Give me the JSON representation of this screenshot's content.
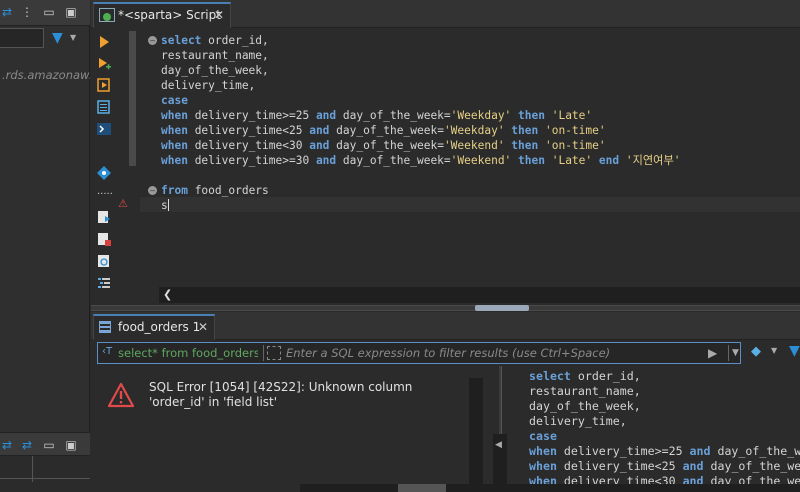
{
  "left_panel": {
    "host_text": ".rds.amazonaw...",
    "icons": [
      "sync-icon",
      "menu-icon",
      "minimize-icon",
      "maximize-icon",
      "filter-icon"
    ]
  },
  "editor": {
    "tab_label": "*<sparta> Script",
    "tab_close": "✕",
    "code_lines": [
      {
        "fold": true,
        "tokens": [
          {
            "t": "select ",
            "c": "kw"
          },
          {
            "t": "order_id,",
            "c": "tx"
          }
        ]
      },
      {
        "tokens": [
          {
            "t": "restaurant_name,",
            "c": "tx"
          }
        ]
      },
      {
        "tokens": [
          {
            "t": "day_of_the_week,",
            "c": "tx"
          }
        ]
      },
      {
        "tokens": [
          {
            "t": "delivery_time,",
            "c": "tx"
          }
        ]
      },
      {
        "tokens": [
          {
            "t": "case",
            "c": "kw"
          }
        ]
      },
      {
        "tokens": [
          {
            "t": "when ",
            "c": "kw"
          },
          {
            "t": "delivery_time>=25 ",
            "c": "tx"
          },
          {
            "t": "and ",
            "c": "kw"
          },
          {
            "t": "day_of_the_week=",
            "c": "tx"
          },
          {
            "t": "'Weekday'",
            "c": "str"
          },
          {
            "t": " then ",
            "c": "kw"
          },
          {
            "t": "'Late'",
            "c": "str"
          }
        ]
      },
      {
        "tokens": [
          {
            "t": "when ",
            "c": "kw"
          },
          {
            "t": "delivery_time<25 ",
            "c": "tx"
          },
          {
            "t": "and ",
            "c": "kw"
          },
          {
            "t": "day_of_the_week=",
            "c": "tx"
          },
          {
            "t": "'Weekday'",
            "c": "str"
          },
          {
            "t": " then ",
            "c": "kw"
          },
          {
            "t": "'on-time'",
            "c": "str"
          }
        ]
      },
      {
        "tokens": [
          {
            "t": "when ",
            "c": "kw"
          },
          {
            "t": "delivery_time<30 ",
            "c": "tx"
          },
          {
            "t": "and ",
            "c": "kw"
          },
          {
            "t": "day_of_the_week=",
            "c": "tx"
          },
          {
            "t": "'Weekend'",
            "c": "str"
          },
          {
            "t": " then ",
            "c": "kw"
          },
          {
            "t": "'on-time'",
            "c": "str"
          }
        ]
      },
      {
        "tokens": [
          {
            "t": "when ",
            "c": "kw"
          },
          {
            "t": "delivery_time>=30 ",
            "c": "tx"
          },
          {
            "t": "and ",
            "c": "kw"
          },
          {
            "t": "day_of_the_week=",
            "c": "tx"
          },
          {
            "t": "'Weekend'",
            "c": "str"
          },
          {
            "t": " then ",
            "c": "kw"
          },
          {
            "t": "'Late'",
            "c": "str"
          },
          {
            "t": " end ",
            "c": "kw"
          },
          {
            "t": "'지연여부'",
            "c": "str"
          }
        ]
      },
      {
        "tokens": []
      },
      {
        "fold": true,
        "tokens": [
          {
            "t": "from ",
            "c": "kw"
          },
          {
            "t": "food_orders",
            "c": "tx"
          }
        ]
      },
      {
        "tokens": [
          {
            "t": "s",
            "c": "tx"
          }
        ]
      }
    ]
  },
  "results": {
    "tab_label": "food_orders 1",
    "tab_close": "✕",
    "filter_query": "select* from food_orders",
    "filter_placeholder": "Enter a SQL expression to filter results (use Ctrl+Space)",
    "filter_sql_icon": "‹T",
    "error_message": "SQL Error [1054] [42S22]: Unknown column 'order_id' in 'field list'",
    "sql_lines": [
      [
        {
          "t": "select ",
          "c": "kw"
        },
        {
          "t": "order_id,",
          "c": "tx"
        }
      ],
      [
        {
          "t": "restaurant_name,",
          "c": "tx"
        }
      ],
      [
        {
          "t": "day_of_the_week,",
          "c": "tx"
        }
      ],
      [
        {
          "t": "delivery_time,",
          "c": "tx"
        }
      ],
      [
        {
          "t": "case",
          "c": "kw"
        }
      ],
      [
        {
          "t": "when ",
          "c": "kw"
        },
        {
          "t": "delivery_time>=25 ",
          "c": "tx"
        },
        {
          "t": "and ",
          "c": "kw"
        },
        {
          "t": "day_of_the_w",
          "c": "tx"
        }
      ],
      [
        {
          "t": "when ",
          "c": "kw"
        },
        {
          "t": "delivery_time<25 ",
          "c": "tx"
        },
        {
          "t": "and ",
          "c": "kw"
        },
        {
          "t": "day_of_the_we",
          "c": "tx"
        }
      ],
      [
        {
          "t": "when ",
          "c": "kw"
        },
        {
          "t": "delivery_time<30 ",
          "c": "tx"
        },
        {
          "t": "and ",
          "c": "kw"
        },
        {
          "t": "day_of_the_we",
          "c": "tx"
        }
      ]
    ]
  },
  "colors": {
    "keyword": "#6aa0d8",
    "string": "#e6d087",
    "text": "#d4d4d4",
    "error": "#e04a4a",
    "filter_query": "#5fa85f",
    "accent": "#4a7fb5"
  }
}
